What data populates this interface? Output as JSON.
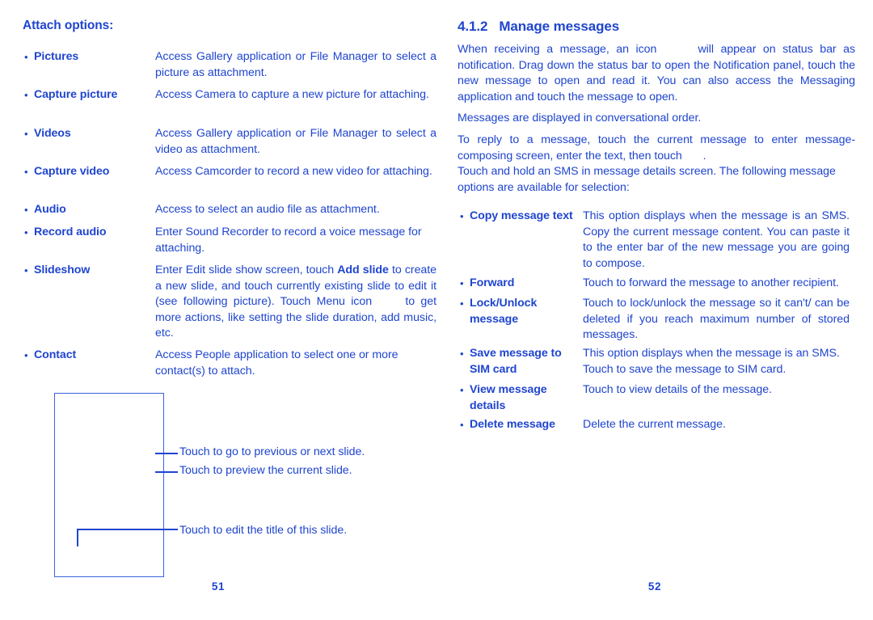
{
  "document": {
    "text_color": "#1f45cf",
    "background_color": "#ffffff"
  },
  "left_page": {
    "folio": "51",
    "heading": "Attach options:",
    "options": [
      {
        "bullet": "•",
        "term": "Pictures",
        "desc_html": "Access Gallery application or File Manager to select a picture as attachment.",
        "desc": "Access Gallery application or File Manager to select a picture as attachment."
      },
      {
        "bullet": "•",
        "term": "Capture picture",
        "desc_html": "Access Camera to capture a new picture for attaching.",
        "desc": "Access Camera to capture a new picture for attaching."
      },
      {
        "bullet": "•",
        "term": "Videos",
        "desc_html": "Access Gallery application or File Manager to select a video as attachment.",
        "desc": "Access Gallery application or File Manager to select a video as attachment."
      },
      {
        "bullet": "•",
        "term": "Capture video",
        "desc_html": "Access Camcorder to record a new video for attaching.",
        "desc": "Access Camcorder to record a new video for attaching."
      },
      {
        "bullet": "•",
        "term": "Audio",
        "desc_html": "Access to select an audio file as attachment.",
        "desc": "Access to select an audio file as attachment."
      },
      {
        "bullet": "•",
        "term": "Record audio",
        "desc_html": "Enter Sound Recorder to record a voice message for attaching.",
        "desc": "Enter Sound Recorder to record a voice message for attaching."
      },
      {
        "bullet": "•",
        "term": "Slideshow",
        "desc_html": "Enter Edit slide show screen, touch <b>Add slide</b> to create a new slide, and touch currently existing slide to edit it (see following picture). Touch Menu icon <span class=\"inline-gap\" data-name=\"menu-icon-placeholder\"></span>to get more actions, like setting the slide duration, add music, etc.",
        "desc": "Enter Edit slide show screen, touch Add slide to create a new slide, and touch currently existing slide to edit it (see following picture). Touch Menu icon  to get more actions, like setting the slide duration, add music, etc."
      },
      {
        "bullet": "•",
        "term": "Contact",
        "desc_html": "Access People application to select one or more contact(s) to attach.",
        "desc": "Access People application to select one or more contact(s) to attach."
      }
    ],
    "diagram": {
      "callouts": [
        "Touch to go to previous or next slide.",
        "Touch to preview the current slide.",
        "Touch to edit the title of this slide."
      ]
    }
  },
  "right_page": {
    "folio": "52",
    "section_number": "4.1.2",
    "section_title": "Manage messages",
    "paragraphs": [
      {
        "html": "When receiving a message, an icon <span class=\"inline-gap\" data-name=\"new-message-icon-placeholder\"></span> will appear on status bar as notification. Drag down the status bar to open the Notification panel, touch the new message to open and read it. You can also access the Messaging application and touch the message to open.",
        "text": "When receiving a message, an icon  will appear on status bar as notification. Drag down the status bar to open the Notification panel, touch the new message to open and read it. You can also access the Messaging application and touch the message to open."
      },
      {
        "html": "Messages are displayed in conversational order.",
        "text": "Messages are displayed in conversational order."
      },
      {
        "html": "To reply to a message, touch the current message to enter message-composing screen, enter the text, then touch <span class=\"inline-gap-sm\" data-name=\"send-icon-placeholder\"></span>.",
        "text": "To reply to a message, touch the current message to enter message-composing screen, enter the text, then touch ."
      },
      {
        "html": "Touch and hold an SMS in message details screen. The following message options are available for selection:",
        "text": "Touch and hold an SMS in message details screen. The following message options are available for selection:"
      }
    ],
    "options": [
      {
        "bullet": "•",
        "term": "Copy message text",
        "desc_html": "This option displays when the message is an SMS. Copy the current message content. You can paste it to the enter bar of the new message you are going to compose.",
        "desc": "This option displays when the message is an SMS. Copy the current message content. You can paste it to the enter bar of the new message you are going to compose."
      },
      {
        "bullet": "•",
        "term": "Forward",
        "desc_html": "Touch to forward the message to another recipient.",
        "desc": "Touch to forward the message to another recipient."
      },
      {
        "bullet": "•",
        "term": "Lock/Unlock message",
        "desc_html": "Touch to lock/unlock the message so it can't/ can be deleted if you reach maximum number of stored messages.",
        "desc": "Touch to lock/unlock the message so it can't/ can be deleted if you reach maximum number of stored messages."
      },
      {
        "bullet": "•",
        "term": "Save message to SIM card",
        "desc_html": "This option displays when the message is an SMS. Touch to save the message to SIM card.",
        "desc": "This option displays when the message is an SMS. Touch to save the message to SIM card."
      },
      {
        "bullet": "•",
        "term": "View message details",
        "desc_html": "Touch to view details of the message.",
        "desc": "Touch to view details of the message."
      },
      {
        "bullet": "•",
        "term": "Delete message",
        "desc_html": "Delete the current message.",
        "desc": "Delete the current message."
      }
    ]
  }
}
